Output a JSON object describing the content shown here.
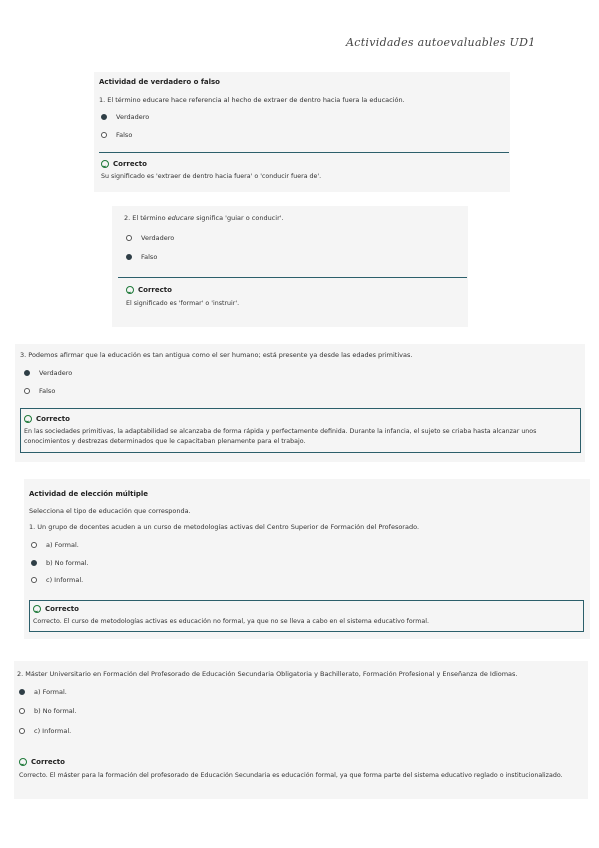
{
  "doc_title": "Actividades autoevaluables UD1",
  "card1": {
    "header": "Actividad de verdadero o falso",
    "question": "1. El término educare hace referencia al hecho de extraer de dentro hacia fuera la educación.",
    "options": [
      "Verdadero",
      "Falso"
    ],
    "selected": 0,
    "feedback_title": "Correcto",
    "feedback_text": "Su significado es 'extraer de dentro hacia fuera' o 'conducir fuera de'."
  },
  "card2": {
    "question_prefix": "2. El término ",
    "question_term": "educare",
    "question_suffix": " significa 'guiar o conducir'.",
    "options": [
      "Verdadero",
      "Falso"
    ],
    "selected": 1,
    "feedback_title": "Correcto",
    "feedback_text": "El significado es 'formar' o 'instruir'."
  },
  "card3": {
    "question": "3. Podemos afirmar que la educación es tan antigua como el ser humano; está presente ya desde las edades primitivas.",
    "options": [
      "Verdadero",
      "Falso"
    ],
    "selected": 0,
    "feedback_title": "Correcto",
    "feedback_text": "En las sociedades primitivas, la adaptabilidad se alcanzaba de forma rápida y perfectamente definida. Durante la infancia, el sujeto se criaba hasta alcanzar unos conocimientos y destrezas determinados que le capacitaban plenamente para el trabajo."
  },
  "card4": {
    "header": "Actividad de elección múltiple",
    "instruction": "Selecciona el tipo de educación que corresponda.",
    "question": "1. Un grupo de docentes acuden a un curso de metodologías activas del Centro Superior de Formación del Profesorado.",
    "options": [
      "a) Formal.",
      "b) No formal.",
      "c) Informal."
    ],
    "selected": 1,
    "feedback_title": "Correcto",
    "feedback_text": "Correcto. El curso de metodologías activas es educación no formal, ya que no se lleva a cabo en el sistema educativo formal."
  },
  "card5": {
    "question": "2. Máster Universitario en Formación del Profesorado de Educación Secundaria Obligatoria y Bachillerato, Formación Profesional y Enseñanza de Idiomas.",
    "options": [
      "a) Formal.",
      "b) No formal.",
      "c) Informal."
    ],
    "selected": 0,
    "feedback_title": "Correcto",
    "feedback_text": "Correcto. El máster para la formación del profesorado de Educación Secundaria es educación formal, ya que forma parte del sistema educativo reglado o institucionalizado."
  }
}
